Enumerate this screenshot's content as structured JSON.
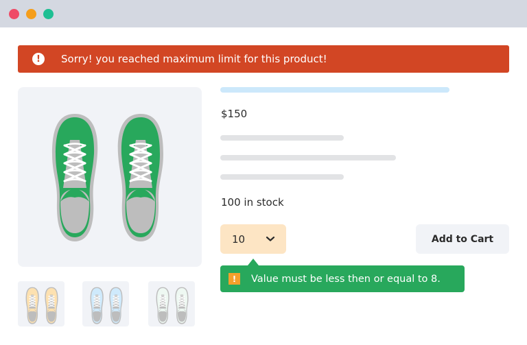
{
  "window": {
    "controls": [
      "close",
      "minimize",
      "maximize"
    ],
    "colors": {
      "close": "#ef4a66",
      "minimize": "#f59e1b",
      "maximize": "#1ebf93"
    }
  },
  "alert": {
    "icon": "exclamation-circle-icon",
    "message": "Sorry! you reached maximum limit for this product!",
    "color": "#d24624"
  },
  "product": {
    "price": "$150",
    "stock": "100 in stock",
    "main_image": {
      "icon": "sneakers-pair",
      "color": "#28a85c"
    },
    "thumbnails": [
      {
        "icon": "sneakers-pair",
        "color": "#fde1b0"
      },
      {
        "icon": "sneakers-pair",
        "color": "#cfeafc"
      },
      {
        "icon": "sneakers-pair",
        "color": "#eef8f2"
      }
    ]
  },
  "quantity": {
    "value": "10",
    "icon": "chevron-down-icon"
  },
  "add_to_cart": {
    "label": "Add to Cart"
  },
  "validation": {
    "icon": "warning-icon",
    "message": "Value must be less then or equal to 8.",
    "color": "#28a85c"
  }
}
